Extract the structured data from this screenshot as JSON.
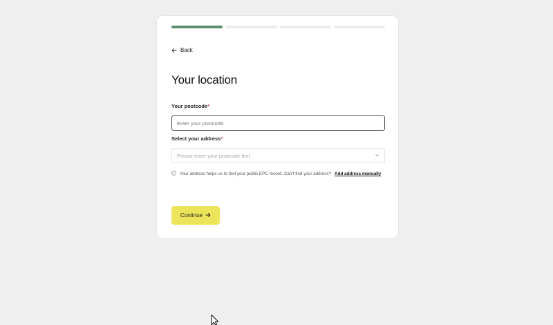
{
  "progress": {
    "total_steps": 4,
    "current_step": 1
  },
  "nav": {
    "back_label": "Back"
  },
  "page": {
    "title": "Your location"
  },
  "postcode": {
    "label": "Your postcode",
    "required_marker": "*",
    "placeholder": "Enter your postcode",
    "value": ""
  },
  "address": {
    "label": "Select your address",
    "required_marker": "*",
    "placeholder": "Please enter your postcode first"
  },
  "helper": {
    "text": "Your address helps us to find your public EPC record. Can't find your address?",
    "link_label": "Add address manually"
  },
  "actions": {
    "continue_label": "Continue"
  },
  "colors": {
    "background": "#efefef",
    "progress_active": "#5b8f6e",
    "progress_inactive": "#ececec",
    "required": "#d0393b",
    "primary_button": "#ece45a"
  },
  "icons": {
    "back": "arrow-left-icon",
    "select": "chevron-down-icon",
    "info": "info-circle-icon",
    "continue": "arrow-right-icon",
    "cursor": "mouse-pointer-icon"
  }
}
